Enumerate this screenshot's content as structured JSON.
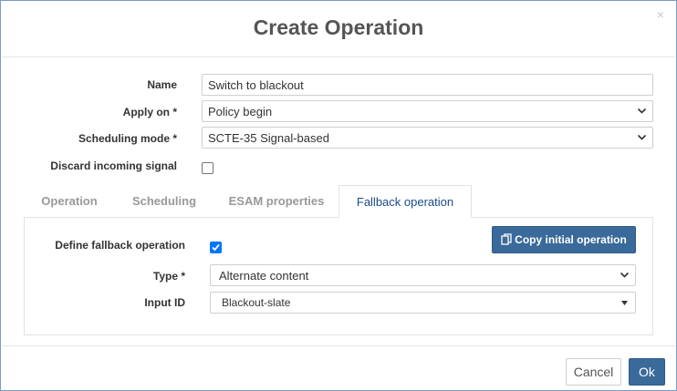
{
  "dialog": {
    "title": "Create Operation",
    "close_glyph": "×"
  },
  "form": {
    "name_label": "Name",
    "name_value": "Switch to blackout",
    "apply_on_label": "Apply on *",
    "apply_on_value": "Policy begin",
    "scheduling_mode_label": "Scheduling mode *",
    "scheduling_mode_value": "SCTE-35 Signal-based",
    "discard_label": "Discard incoming signal",
    "discard_checked": false
  },
  "tabs": [
    {
      "label": "Operation",
      "active": false
    },
    {
      "label": "Scheduling",
      "active": false
    },
    {
      "label": "ESAM properties",
      "active": false
    },
    {
      "label": "Fallback operation",
      "active": true
    }
  ],
  "fallback": {
    "define_label": "Define fallback operation",
    "define_checked": true,
    "copy_button_label": "Copy initial operation",
    "type_label": "Type *",
    "type_value": "Alternate content",
    "input_id_label": "Input ID",
    "input_id_value": "Blackout-slate"
  },
  "footer": {
    "cancel_label": "Cancel",
    "ok_label": "Ok"
  },
  "icons": {
    "close": "close-icon",
    "copy": "copy-icon",
    "chevron": "chevron-down-icon",
    "caret": "caret-down-icon",
    "check": "check-icon"
  },
  "colors": {
    "primary": "#3a6a9a",
    "checkbox": "#0075ff",
    "active_tab_text": "#1a4a8a"
  }
}
